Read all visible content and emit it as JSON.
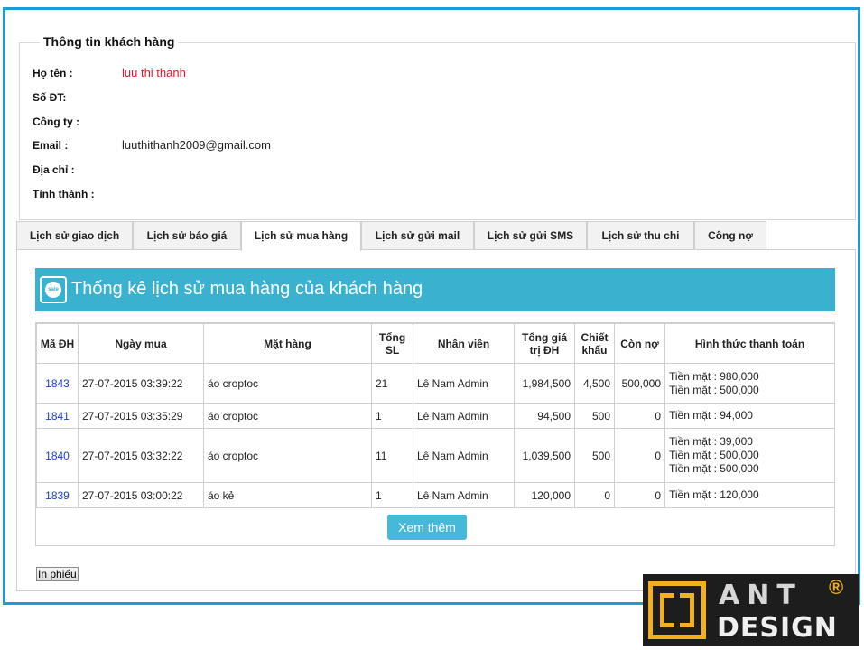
{
  "customer_info": {
    "legend": "Thông tin khách hàng",
    "fields": [
      {
        "label": "Họ tên :",
        "value": "luu thi thanh"
      },
      {
        "label": "Số ĐT:",
        "value": ""
      },
      {
        "label": "Công ty :",
        "value": ""
      },
      {
        "label": "Email :",
        "value": "luuthithanh2009@gmail.com"
      },
      {
        "label": "Địa chỉ :",
        "value": ""
      },
      {
        "label": "Tỉnh thành :",
        "value": ""
      }
    ]
  },
  "tabs": [
    {
      "label": "Lịch sử giao dịch",
      "active": false
    },
    {
      "label": "Lịch sử báo giá",
      "active": false
    },
    {
      "label": "Lịch sử mua hàng",
      "active": true
    },
    {
      "label": "Lịch sử gửi mail",
      "active": false
    },
    {
      "label": "Lịch sử gửi SMS",
      "active": false
    },
    {
      "label": "Lịch sử thu chi",
      "active": false
    },
    {
      "label": "Công nợ",
      "active": false
    }
  ],
  "panel": {
    "banner_icon_text": "sale",
    "banner_title": "Thống kê lịch sử mua hàng của khách hàng",
    "table": {
      "headers": {
        "order_id": "Mã ĐH",
        "date": "Ngày mua",
        "item": "Mặt hàng",
        "qty_line1": "Tổng",
        "qty_line2": "SL",
        "staff": "Nhân viên",
        "total_line1": "Tổng giá",
        "total_line2": "trị ĐH",
        "discount_line1": "Chiết",
        "discount_line2": "khấu",
        "debt": "Còn nợ",
        "payment": "Hình thức thanh toán"
      },
      "rows": [
        {
          "order_id": "1843",
          "date": "27-07-2015 03:39:22",
          "item": "áo croptoc",
          "qty": "21",
          "staff": "Lê Nam Admin",
          "total": "1,984,500",
          "discount": "4,500",
          "debt": "500,000",
          "payments": [
            "Tiền mặt : 980,000",
            "Tiền mặt : 500,000"
          ]
        },
        {
          "order_id": "1841",
          "date": "27-07-2015 03:35:29",
          "item": "áo croptoc",
          "qty": "1",
          "staff": "Lê Nam Admin",
          "total": "94,500",
          "discount": "500",
          "debt": "0",
          "payments": [
            "Tiền mặt : 94,000"
          ]
        },
        {
          "order_id": "1840",
          "date": "27-07-2015 03:32:22",
          "item": "áo croptoc",
          "qty": "11",
          "staff": "Lê Nam Admin",
          "total": "1,039,500",
          "discount": "500",
          "debt": "0",
          "payments": [
            "Tiền mặt : 39,000",
            "Tiền mặt : 500,000",
            "Tiền mặt : 500,000"
          ]
        },
        {
          "order_id": "1839",
          "date": "27-07-2015 03:00:22",
          "item": "áo kẻ",
          "qty": "1",
          "staff": "Lê Nam Admin",
          "total": "120,000",
          "discount": "0",
          "debt": "0",
          "payments": [
            "Tiền mặt : 120,000"
          ]
        }
      ]
    },
    "more_button": "Xem thêm",
    "print_button": "In phiếu"
  },
  "logo": {
    "top_text": "ANT",
    "bottom_text": "DESIGN",
    "reg_mark": "®"
  },
  "colors": {
    "frame_border": "#1e9ad6",
    "banner": "#39b1cf",
    "name_value": "#e0182d",
    "order_link": "#1a3fc4",
    "more_button": "#46b8da",
    "logo_gold": "#f2b01e"
  }
}
